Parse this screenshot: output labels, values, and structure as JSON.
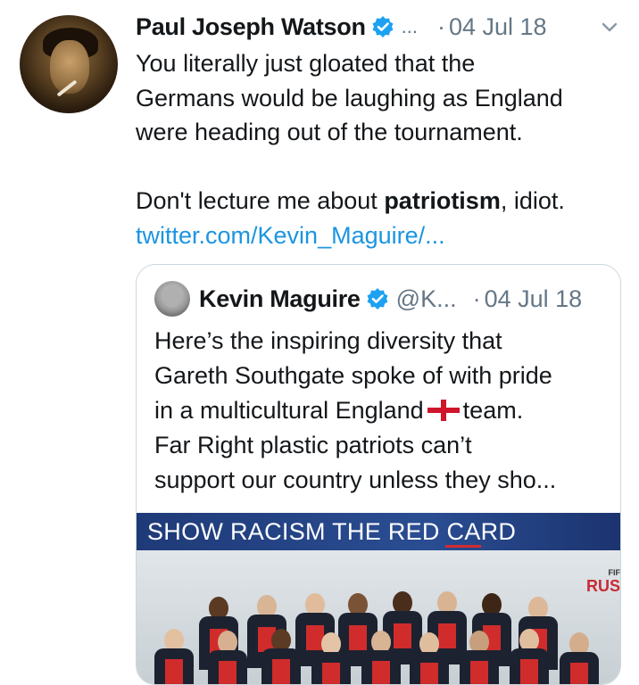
{
  "tweet": {
    "author_name": "Paul Joseph Watson",
    "truncation": "...",
    "separator": "·",
    "date": "04 Jul 18",
    "text_lines": [
      "You literally just gloated that the",
      "Germans would be laughing as England",
      "were heading out of the tournament."
    ],
    "text2_before": "Don't lecture me about ",
    "text2_bold": "patriotism",
    "text2_after": ", idiot.",
    "link_text": "twitter.com/Kevin_Maguire/..."
  },
  "quoted": {
    "author_name": "Kevin Maguire",
    "handle": "@K...",
    "separator": "·",
    "date": "04 Jul 18",
    "line1": "Here’s the inspiring diversity that",
    "line2": "Gareth Southgate spoke of with pride",
    "line3_before": "in a multicultural England",
    "line3_after": "team.",
    "line4": "Far Right plastic patriots can’t",
    "line5": "support our country unless they sho...",
    "image": {
      "banner_text": "SHOW RACISM THE RED CARD",
      "corner_text_1": "FIF",
      "corner_text_2": "RUS"
    }
  },
  "icons": {
    "verified": "verified-badge-icon",
    "chevron": "chevron-down-icon",
    "flag": "england-flag-icon"
  },
  "colors": {
    "link": "#1b95e0",
    "muted": "#657786",
    "verified": "#1da1f2",
    "banner": "#2a4d92",
    "red_card": "#d02c2c"
  }
}
